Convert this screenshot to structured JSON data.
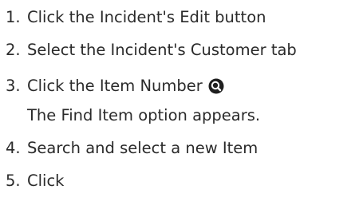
{
  "steps": [
    {
      "number": "1.",
      "text": "Click the Incident's Edit button"
    },
    {
      "number": "2.",
      "text": "Select the Incident's Customer tab"
    },
    {
      "number": "3.",
      "text": "Click the Item Number",
      "icon": "search-icon",
      "note": "The Find Item option appears."
    },
    {
      "number": "4.",
      "text": "Search and select a new Item"
    },
    {
      "number": "5.",
      "text": "Click"
    }
  ],
  "colors": {
    "text": "#2a2a2a",
    "icon_fill": "#1f1f1f"
  }
}
